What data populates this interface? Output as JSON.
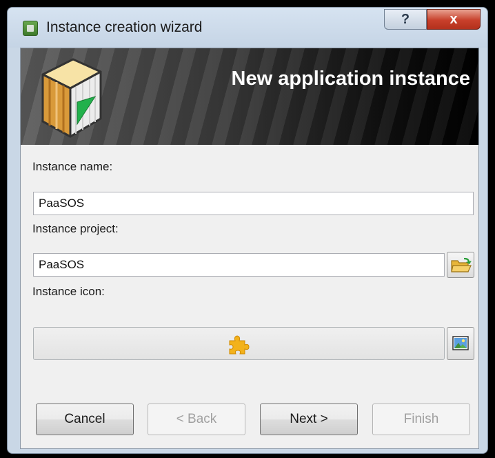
{
  "window": {
    "title": "Instance creation wizard",
    "help_label": "?",
    "close_label": "x"
  },
  "banner": {
    "title": "New application instance"
  },
  "form": {
    "name_label": "Instance name:",
    "name_value": "PaaSOS",
    "project_label": "Instance project:",
    "project_value": "PaaSOS",
    "icon_label": "Instance icon:",
    "project_browse_icon": "open-folder-icon",
    "icon_browse_icon": "image-icon",
    "icon_preview": "puzzle-piece-icon"
  },
  "buttons": {
    "cancel": "Cancel",
    "back": "< Back",
    "next": "Next >",
    "finish": "Finish"
  },
  "colors": {
    "banner_dark": "#000000",
    "banner_text": "#ffffff",
    "close_button": "#c8402b",
    "puzzle": "#f3b21b",
    "logo_green": "#22b14c"
  }
}
